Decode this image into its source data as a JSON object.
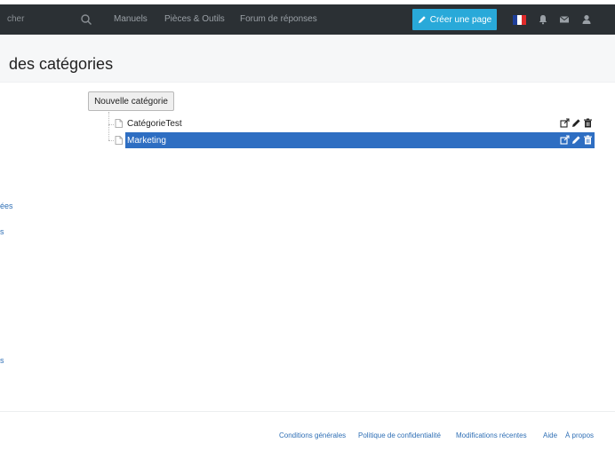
{
  "navbar": {
    "search_text": "cher",
    "links": [
      "Manuels",
      "Pièces & Outils",
      "Forum de réponses"
    ],
    "create_button": "Créer une page",
    "accent": "#29a9d9",
    "flag_colors": [
      "#1f3f9a",
      "#ffffff",
      "#e02a2a"
    ]
  },
  "page": {
    "title": "des catégories"
  },
  "tree": {
    "new_button": "Nouvelle catégorie",
    "items": [
      {
        "label": "CatégorieTest",
        "selected": false
      },
      {
        "label": "Marketing",
        "selected": true
      }
    ],
    "selected_color": "#2e6ec2"
  },
  "sidebar": {
    "links": [
      "ées",
      "s",
      "s"
    ]
  },
  "footer": {
    "links": [
      "Conditions générales",
      "Politique de confidentialité",
      "Modifications récentes",
      "Aide",
      "À propos"
    ]
  }
}
